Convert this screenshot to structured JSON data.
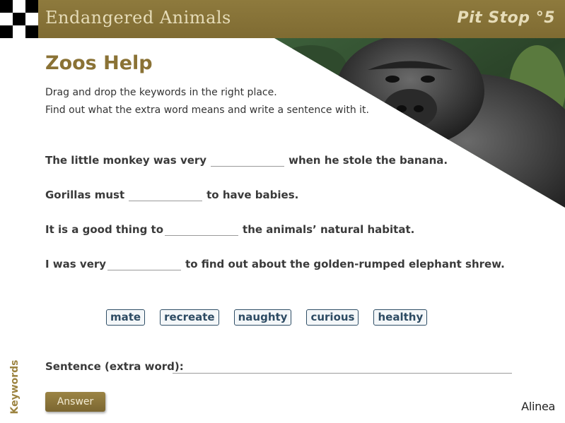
{
  "header": {
    "app_title": "Endangered Animals",
    "pit_stop": "Pit Stop °5"
  },
  "main": {
    "title": "Zoos Help",
    "instructions": [
      "Drag and drop the keywords in the right place.",
      "Find out what the extra word means and write a sentence with it."
    ],
    "sentences": [
      {
        "before": "The little monkey was very",
        "after": "when he stole the banana."
      },
      {
        "before": "Gorillas must",
        "after": "to have babies."
      },
      {
        "before": "It is a good thing to",
        "after": "the animals’ natural habitat."
      },
      {
        "before": "I was very",
        "after": "to find out about the golden-rumped elephant shrew."
      }
    ],
    "keywords": [
      "mate",
      "recreate",
      "naughty",
      "curious",
      "healthy"
    ],
    "keywords_tab": "Keywords",
    "extra_label": "Sentence (extra word):",
    "extra_value": "",
    "answer_label": "Answer"
  },
  "footer": {
    "logo": "Alinea"
  },
  "colors": {
    "header_bg": "#8e7a3d",
    "title": "#8a7235",
    "keyword_border": "#2f4e66"
  }
}
